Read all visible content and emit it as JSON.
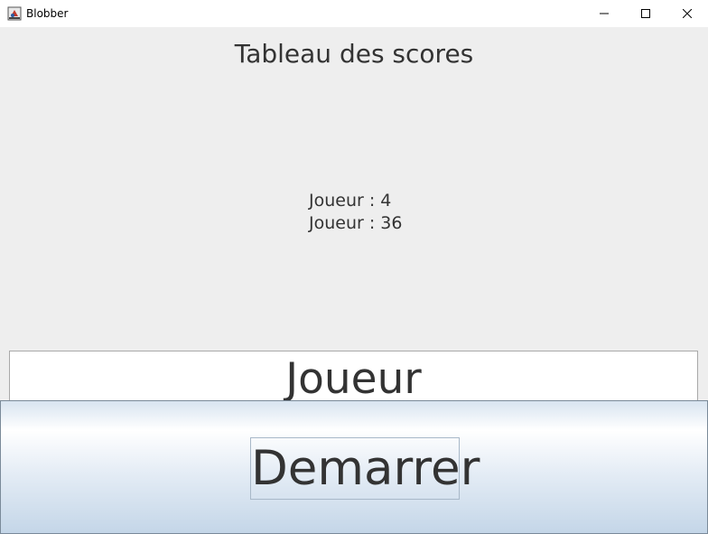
{
  "window": {
    "title": "Blobber",
    "controls": [
      "minimize",
      "maximize",
      "close"
    ]
  },
  "scoreboard": {
    "title": "Tableau des scores",
    "entries": [
      "Joueur : 4",
      "Joueur : 36"
    ]
  },
  "player_input": {
    "value": "Joueur"
  },
  "start_button": {
    "label": "Demarrer"
  }
}
